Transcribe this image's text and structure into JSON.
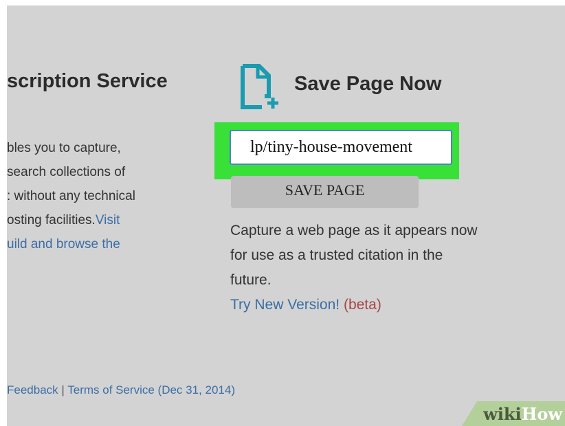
{
  "left": {
    "title": "scription Service",
    "desc_lines": [
      "bles you to capture,",
      "search collections of",
      ": without any technical",
      "osting facilities."
    ],
    "visit_link": "Visit",
    "last_line_link": "uild and browse the"
  },
  "save_page": {
    "title": "Save Page Now",
    "icon": "document-add-icon",
    "url_value": "lp/tiny-house-movement",
    "button_label": "SAVE PAGE",
    "desc_lines": [
      "Capture a web page as it appears now",
      "for use as a trusted citation in the",
      "future."
    ],
    "try_link": "Try New Version!",
    "beta": "(beta)"
  },
  "footer": {
    "feedback": "Feedback",
    "separator": " | ",
    "terms": "Terms of Service (Dec 31, 2014)"
  },
  "watermark": {
    "wiki": "wiki",
    "how": "How"
  },
  "colors": {
    "highlight": "#38e038",
    "link": "#3b6ea5",
    "icon": "#1a9bb0"
  }
}
